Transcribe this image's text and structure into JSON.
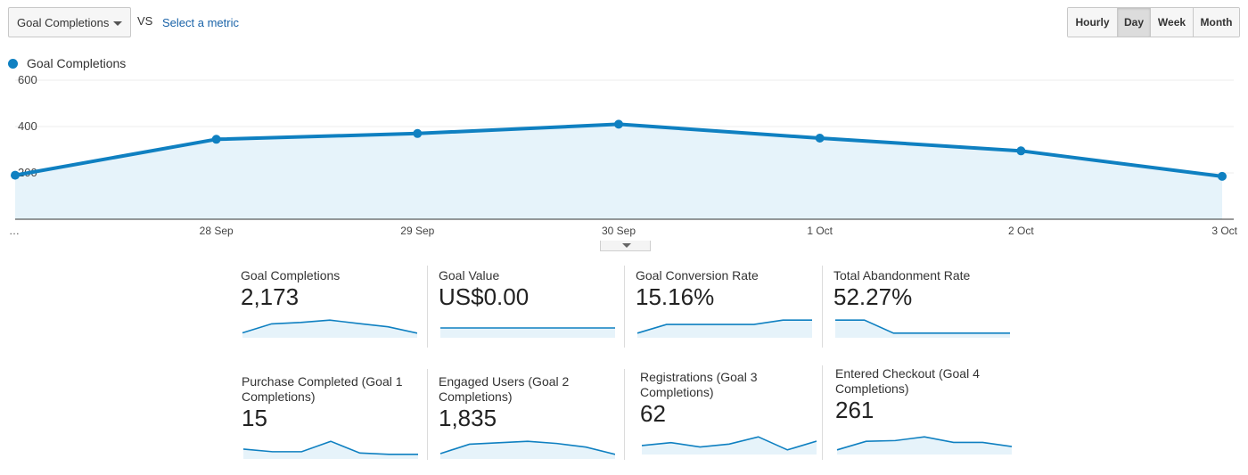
{
  "toolbar": {
    "metric_select_value": "Goal Completions",
    "vs_label": "VS",
    "select_metric_link": "Select a metric",
    "granularity": [
      {
        "label": "Hourly",
        "active": false
      },
      {
        "label": "Day",
        "active": true
      },
      {
        "label": "Week",
        "active": false
      },
      {
        "label": "Month",
        "active": false
      }
    ]
  },
  "legend": {
    "label": "Goal Completions",
    "color": "#0f80c1"
  },
  "chart_data": {
    "type": "area",
    "title": "",
    "series": [
      {
        "name": "Goal Completions",
        "values": [
          190,
          345,
          370,
          410,
          350,
          295,
          185
        ]
      }
    ],
    "x": [
      "…",
      "28 Sep",
      "29 Sep",
      "30 Sep",
      "1 Oct",
      "2 Oct",
      "3 Oct"
    ],
    "xlabel": "",
    "ylabel": "",
    "ylim": [
      0,
      600
    ],
    "yticks": [
      200,
      400,
      600
    ],
    "ytick_labels": [
      "200",
      "400",
      "600"
    ],
    "grid": true,
    "line_color": "#0f80c1",
    "fill_color": "#e6f3fa"
  },
  "tiles": [
    {
      "label": "Goal Completions",
      "value": "2,173",
      "spark": [
        190,
        345,
        370,
        410,
        350,
        295,
        185
      ]
    },
    {
      "label": "Goal Value",
      "value": "US$0.00",
      "spark": [
        0,
        0,
        0,
        0,
        0,
        0,
        0
      ]
    },
    {
      "label": "Goal Conversion Rate",
      "value": "15.16%",
      "spark": [
        14.9,
        15.1,
        15.1,
        15.1,
        15.1,
        15.2,
        15.2
      ]
    },
    {
      "label": "Total Abandonment Rate",
      "value": "52.27%",
      "spark": [
        52.4,
        52.4,
        52.2,
        52.2,
        52.2,
        52.2,
        52.2
      ]
    },
    {
      "label": "Purchase Completed (Goal 1 Completions)",
      "value": "15",
      "spark": [
        2,
        1,
        1,
        5,
        0.5,
        0,
        0
      ]
    },
    {
      "label": "Engaged Users (Goal 2 Completions)",
      "value": "1,835",
      "spark": [
        160,
        290,
        310,
        330,
        300,
        250,
        150
      ]
    },
    {
      "label": "Registrations (Goal 3 Completions)",
      "value": "62",
      "spark": [
        8,
        10,
        7,
        9,
        14,
        5,
        11
      ]
    },
    {
      "label": "Entered Checkout (Goal 4 Completions)",
      "value": "261",
      "spark": [
        17,
        40,
        42,
        52,
        37,
        37,
        26
      ]
    }
  ]
}
